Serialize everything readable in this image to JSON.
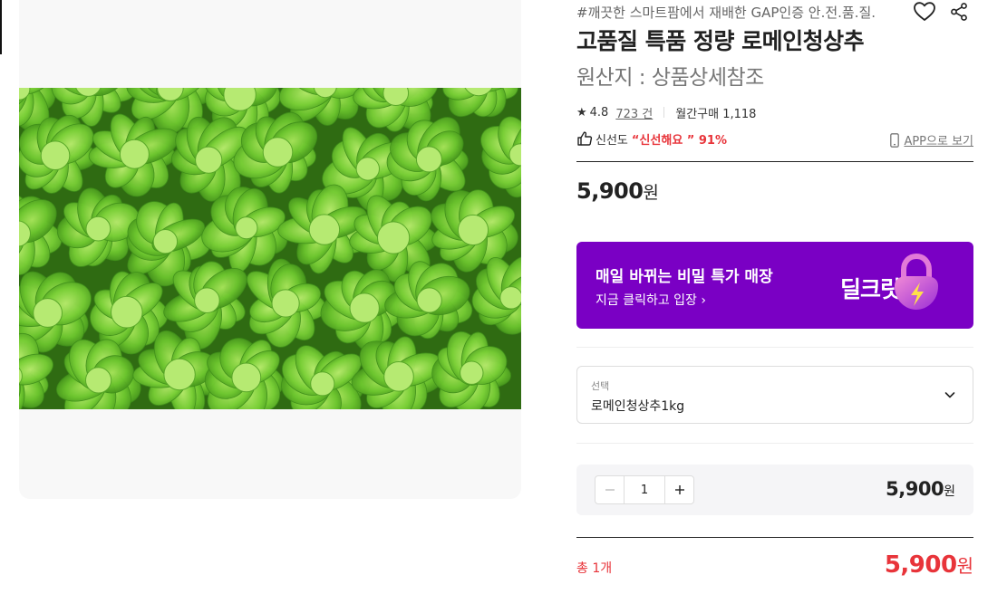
{
  "product": {
    "tagline": "#깨끗한 스마트팜에서 재배한 GAP인증 안.전.품.질.",
    "title": "고품질 특품 정량 로메인청상추",
    "origin": "원산지 : 상품상세참조",
    "image_icon": "lettuce-photo"
  },
  "actions": {
    "wishlist_icon": "heart-icon",
    "share_icon": "share-icon"
  },
  "rating": {
    "star": "★",
    "score": "4.8",
    "review_count": "723 건",
    "monthly_purchases": "월간구매 1,118"
  },
  "freshness": {
    "label": "신선도",
    "quote": "“신선해요 ” 91%"
  },
  "app_link": {
    "label": "APP으로 보기"
  },
  "price": {
    "amount": "5,900",
    "unit": "원"
  },
  "banner": {
    "title": "매일 바뀌는 비밀 특가 매장",
    "subtitle": "지금 클릭하고 입장 ›",
    "logo": "딜크릿",
    "background": "#7a00c4"
  },
  "option": {
    "label": "선택",
    "selected": "로메인청상추1kg"
  },
  "quantity": {
    "value": "1",
    "amount": "5,900",
    "unit": "원"
  },
  "total": {
    "label": "총 1개",
    "amount": "5,900",
    "unit": "원",
    "color": "#e8343a"
  }
}
